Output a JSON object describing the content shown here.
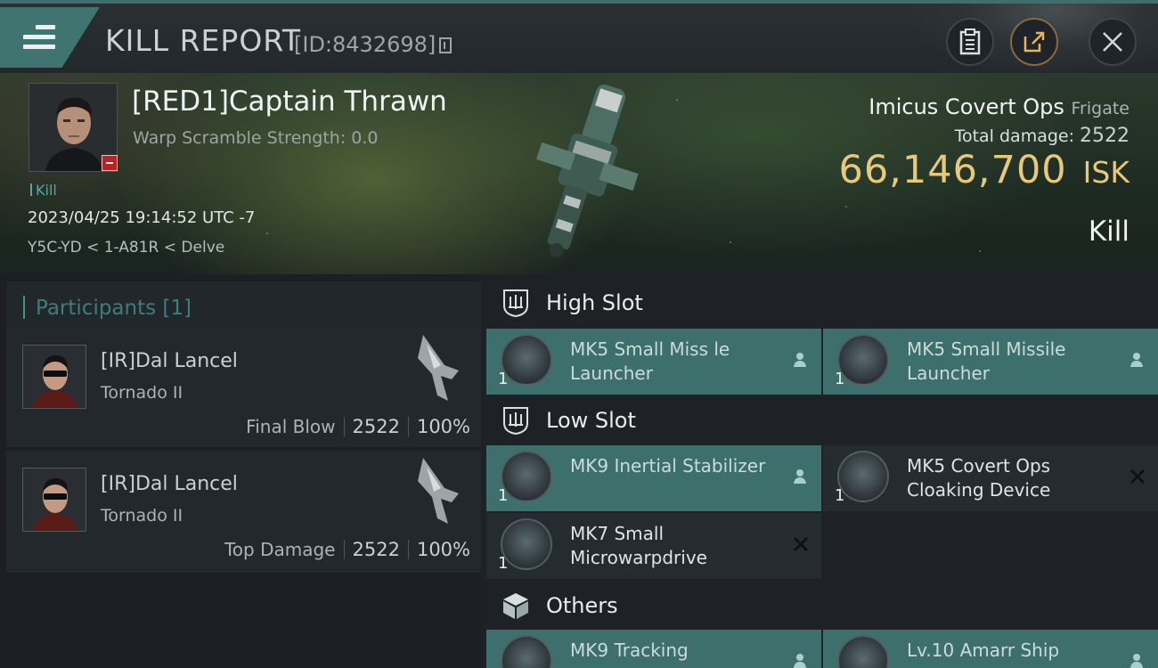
{
  "header": {
    "title": "KILL REPORT",
    "report_id": "[ID:8432698]"
  },
  "victim": {
    "name": "[RED1]Captain Thrawn",
    "warp_scramble": "Warp Scramble Strength: 0.0",
    "tag": "Kill",
    "datetime": "2023/04/25 19:14:52 UTC -7",
    "location": "Y5C-YD < 1-A81R < Delve"
  },
  "ship": {
    "name": "Imicus Covert Ops",
    "class": "Frigate",
    "total_damage_label": "Total damage:",
    "total_damage": "2522",
    "isk_value": "66,146,700",
    "isk_unit": "ISK",
    "result": "Kill"
  },
  "participants": {
    "header": "Participants [1]",
    "list": [
      {
        "name": "[IR]Dal Lancel",
        "ship": "Tornado II",
        "role": "Final Blow",
        "damage": "2522",
        "percent": "100%"
      },
      {
        "name": "[IR]Dal Lancel",
        "ship": "Tornado II",
        "role": "Top Damage",
        "damage": "2522",
        "percent": "100%"
      }
    ]
  },
  "slots": {
    "high": {
      "label": "High Slot",
      "items": [
        {
          "name": "MK5 Small Miss le Launcher",
          "qty": "1"
        },
        {
          "name": "MK5 Small Missile Launcher",
          "qty": "1"
        }
      ]
    },
    "low": {
      "label": "Low Slot",
      "items": [
        {
          "name": "MK9 Inertial Stabilizer",
          "qty": "1"
        },
        {
          "name": "MK5 Covert Ops Cloaking Device",
          "qty": "1"
        },
        {
          "name": "MK7 Small Microwarpdrive",
          "qty": "1"
        }
      ]
    },
    "others": {
      "label": "Others",
      "items": [
        {
          "name": "MK9 Tracking"
        },
        {
          "name": "Lv.10 Amarr Ship"
        }
      ]
    }
  },
  "colors": {
    "accent_teal": "#3d706d",
    "isk_gold": "#e8c87a",
    "destroyed_red": "#c02020"
  }
}
